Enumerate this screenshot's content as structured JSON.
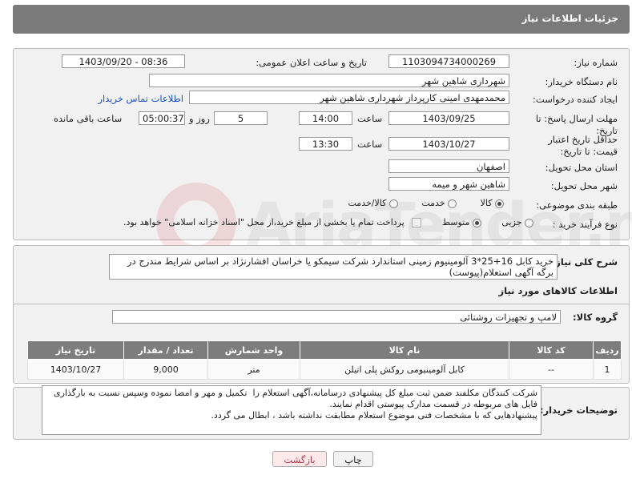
{
  "header": {
    "title": "جزئیات اطلاعات نیاز"
  },
  "fields": {
    "need_number_label": "شماره نیاز:",
    "need_number": "1103094734000269",
    "announce_label": "تاریخ و ساعت اعلان عمومی:",
    "announce_value": "1403/09/20 - 08:36",
    "buyer_org_label": "نام دستگاه خریدار:",
    "buyer_org": "شهرداری شاهین شهر",
    "creator_label": "ایجاد کننده درخواست:",
    "creator": "محمدمهدی امینی کارپرداز شهرداری شاهین شهر",
    "contact_link": "اطلاعات تماس خریدار",
    "deadline_label": "مهلت ارسال پاسخ: تا تاریخ:",
    "deadline_date": "1403/09/25",
    "time_label": "ساعت",
    "deadline_time": "14:00",
    "days_value": "5",
    "days_label": "روز و",
    "remaining_time": "05:00:37",
    "remaining_label": "ساعت باقی مانده",
    "validity_label": "حداقل تاریخ اعتبار قیمت: تا تاریخ:",
    "validity_date": "1403/10/27",
    "validity_time": "13:30",
    "province_label": "استان محل تحویل:",
    "province": "اصفهان",
    "city_label": "شهر محل تحویل:",
    "city": "شاهین شهر و میمه",
    "category_label": "طبقه بندی موضوعی:",
    "category_options": [
      "کالا",
      "خدمت",
      "کالا/خدمت"
    ],
    "process_label": "نوع فرآیند خرید :",
    "process_options": [
      "جزیی",
      "متوسط"
    ],
    "payment_note": "پرداخت تمام یا بخشی از مبلغ خرید،از محل \"اسناد خزانه اسلامی\" خواهد بود."
  },
  "description": {
    "label": "شرح کلی نیاز:",
    "text": "خرید کابل 16+25*3 آلومینیوم زمینی استاندارد شرکت سیمکو یا خراسان افشارنژاد بر اساس شرایط مندرج در برگه آگهی استعلام(پیوست)"
  },
  "goods": {
    "section_title": "اطلاعات کالاهای مورد نیاز",
    "group_label": "گروه کالا:",
    "group_value": "لامپ و تجهیزات روشنائی",
    "columns": [
      "ردیف",
      "کد کالا",
      "نام کالا",
      "واحد شمارش",
      "تعداد / مقدار",
      "تاریخ نیاز"
    ],
    "rows": [
      [
        "1",
        "--",
        "کابل آلومینیومی روکش پلی اتیلن",
        "متر",
        "9,000",
        "1403/10/27"
      ]
    ]
  },
  "buyer_notes": {
    "label": "توضیحات خریدار:",
    "text": "شرکت کنندگان مکلفند ضمن ثبت مبلغ کل پیشنهادی درسامانه،آگهی استعلام را  تکمیل و مهر و امضا نموده وسپس نسبت به بارگذاری فایل های مربوطه در قسمت مدارک پیوستی اقدام نمایند.\nپیشنهادهایی که با مشخصات فنی موضوع استعلام مطابقت نداشته باشد ، ابطال می گردد."
  },
  "buttons": {
    "print": "چاپ",
    "back": "بازگشت"
  },
  "watermark": "AriaTender.neT",
  "colors": {
    "header_bg": "#7a7a7a",
    "panel_bg": "#f1f1f1",
    "link": "#1a4fbf",
    "table_header": "#7d7d7d"
  }
}
